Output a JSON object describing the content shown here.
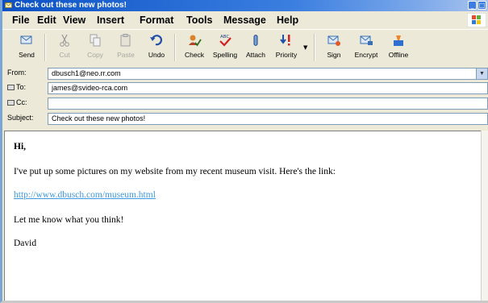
{
  "window": {
    "title": "Check out these new photos!",
    "controls": [
      "minimize",
      "maximize"
    ]
  },
  "menu": {
    "items": [
      "File",
      "Edit",
      "View",
      "Insert",
      "Format",
      "Tools",
      "Message",
      "Help"
    ]
  },
  "toolbar": {
    "buttons": [
      {
        "label": "Send",
        "icon": "send-icon",
        "enabled": true
      },
      {
        "label": "Cut",
        "icon": "scissors-icon",
        "enabled": false
      },
      {
        "label": "Copy",
        "icon": "copy-icon",
        "enabled": false
      },
      {
        "label": "Paste",
        "icon": "paste-icon",
        "enabled": false
      },
      {
        "label": "Undo",
        "icon": "undo-icon",
        "enabled": true
      },
      {
        "label": "Check",
        "icon": "check-names-icon",
        "enabled": true
      },
      {
        "label": "Spelling",
        "icon": "spelling-icon",
        "enabled": true
      },
      {
        "label": "Attach",
        "icon": "paperclip-icon",
        "enabled": true
      },
      {
        "label": "Priority",
        "icon": "priority-icon",
        "enabled": true
      },
      {
        "label": "Sign",
        "icon": "sign-icon",
        "enabled": true
      },
      {
        "label": "Encrypt",
        "icon": "encrypt-icon",
        "enabled": true
      },
      {
        "label": "Offline",
        "icon": "offline-icon",
        "enabled": true
      }
    ]
  },
  "headers": {
    "from_label": "From:",
    "from_value": "dbusch1@neo.rr.com",
    "to_label": "To:",
    "to_value": "james@svideo-rca.com",
    "cc_label": "Cc:",
    "cc_value": "",
    "subject_label": "Subject:",
    "subject_value": "Check out these new photos!"
  },
  "message": {
    "greeting": "Hi,",
    "line1": "I've put up some pictures on my website from my recent museum visit.  Here's the link:",
    "link": "http://www.dbusch.com/museum.html",
    "line2": "Let me know what you think!",
    "signature": "David"
  },
  "colors": {
    "titlebar": "#0b51c5",
    "chrome": "#ece9d8",
    "link": "#3f9ae6",
    "field_border": "#7f9db9"
  }
}
